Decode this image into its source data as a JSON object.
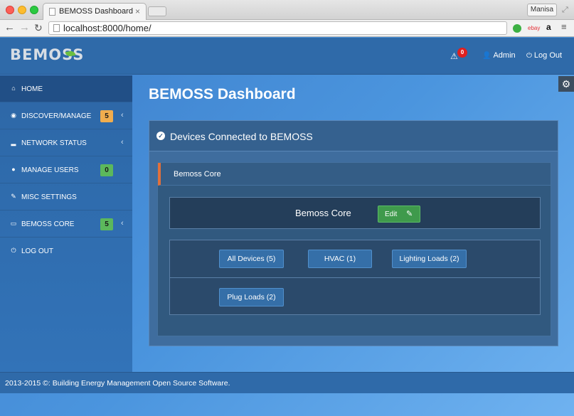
{
  "browser": {
    "tab_title": "BEMOSS Dashboard",
    "tab_close": "×",
    "url": "localhost:8000/home/",
    "profile": "Manisa",
    "back_glyph": "←",
    "forward_glyph": "→",
    "reload_glyph": "↻",
    "fullscreen_glyph": "⤢",
    "ext_ebay": "ebay",
    "ext_amazon": "a",
    "menu_glyph": "≡"
  },
  "header": {
    "logo": "BEMOSS",
    "alert_count": "0",
    "alert_glyph": "⚠",
    "admin_label": "Admin",
    "admin_glyph": "👤",
    "logout_label": "Log Out",
    "logout_glyph": "⏻"
  },
  "sidebar": {
    "items": [
      {
        "label": "HOME",
        "icon": "home-icon",
        "glyph": "⌂"
      },
      {
        "label": "DISCOVER/MANAGE",
        "icon": "globe-icon",
        "glyph": "◉",
        "badge": "5",
        "chevron": "‹"
      },
      {
        "label": "NETWORK STATUS",
        "icon": "signal-icon",
        "glyph": "▂",
        "chevron": "‹"
      },
      {
        "label": "MANAGE USERS",
        "icon": "user-icon",
        "glyph": "●",
        "badge": "0"
      },
      {
        "label": "MISC SETTINGS",
        "icon": "wrench-icon",
        "glyph": "✎"
      },
      {
        "label": "BEMOSS CORE",
        "icon": "monitor-icon",
        "glyph": "▭",
        "badge": "5",
        "chevron": "‹"
      },
      {
        "label": "LOG OUT",
        "icon": "power-icon",
        "glyph": "⏻"
      }
    ]
  },
  "settings_glyph": "⚙",
  "main": {
    "title": "BEMOSS Dashboard",
    "panel_title": "Devices Connected to BEMOSS",
    "panel_check": "✓",
    "inner_title": "Bemoss Core",
    "core_name": "Bemoss Core",
    "edit_label": "Edit",
    "edit_glyph": "✎",
    "categories": [
      {
        "label": "All Devices (5)"
      },
      {
        "label": "HVAC (1)"
      },
      {
        "label": "Lighting Loads (2)"
      },
      {
        "label": "Plug Loads (2)"
      }
    ]
  },
  "footer": {
    "text": "2013-2015 ©: Building Energy Management Open Source Software."
  },
  "colors": {
    "accent": "#2f6aa9",
    "badge_orange": "#f0ad4e",
    "badge_green": "#5cb85c",
    "edit_green": "#3f9a4c",
    "alert_red": "#e02020"
  }
}
